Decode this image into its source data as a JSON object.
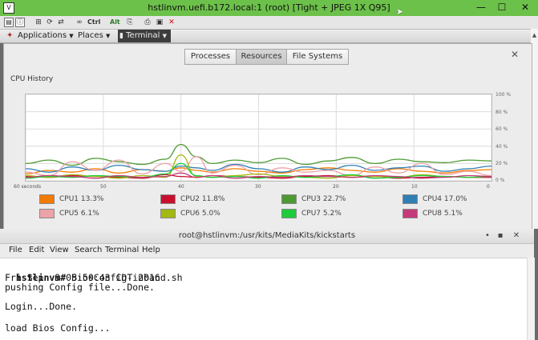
{
  "vnc": {
    "title": "hstlinvm.uefi.b172.local:1 (root) [Tight + JPEG 1X Q95]",
    "controls": {
      "minimize": "—",
      "maximize": "☐",
      "close": "✕"
    },
    "toolbar_texts": {
      "ctrl": "Ctrl",
      "alt": "Alt"
    }
  },
  "panel": {
    "applications": "Applications",
    "places": "Places",
    "terminal_task": "Terminal"
  },
  "sysmon": {
    "tabs": [
      "Processes",
      "Resources",
      "File Systems"
    ],
    "active_tab": "Resources",
    "close_label": "✕",
    "section_title": "CPU History",
    "y_ticks": [
      "100 %",
      "80 %",
      "60 %",
      "40 %",
      "20 %",
      "0 %"
    ],
    "x_ticks": [
      "60 seconds",
      "50",
      "40",
      "30",
      "20",
      "10",
      "0"
    ],
    "legend": [
      {
        "label": "CPU1 13.3%",
        "color": "#f57a00"
      },
      {
        "label": "CPU2 11.8%",
        "color": "#c8102e"
      },
      {
        "label": "CPU3 22.7%",
        "color": "#4e9a32"
      },
      {
        "label": "CPU4 17.0%",
        "color": "#2f7fb5"
      },
      {
        "label": "CPU5 6.1%",
        "color": "#eca2a8"
      },
      {
        "label": "CPU6 5.0%",
        "color": "#a4b812"
      },
      {
        "label": "CPU7 5.2%",
        "color": "#1ccc3a"
      },
      {
        "label": "CPU8 5.1%",
        "color": "#c43b7a"
      }
    ]
  },
  "chart_data": {
    "type": "line",
    "title": "CPU History",
    "x": [
      60,
      57,
      54,
      51,
      48,
      45,
      42,
      40,
      38,
      36,
      33,
      30,
      27,
      24,
      21,
      18,
      15,
      12,
      9,
      6,
      3,
      0
    ],
    "ylim": [
      0,
      100
    ],
    "series": [
      {
        "name": "CPU1",
        "values": [
          8,
          12,
          10,
          14,
          9,
          13,
          11,
          15,
          12,
          10,
          14,
          11,
          9,
          13,
          15,
          12,
          10,
          14,
          11,
          9,
          12,
          13
        ]
      },
      {
        "name": "CPU2",
        "values": [
          5,
          4,
          6,
          5,
          4,
          3,
          7,
          5,
          4,
          6,
          5,
          4,
          3,
          5,
          6,
          4,
          5,
          3,
          4,
          5,
          4,
          4
        ]
      },
      {
        "name": "CPU3",
        "values": [
          20,
          24,
          18,
          26,
          22,
          19,
          25,
          42,
          28,
          20,
          24,
          21,
          26,
          19,
          23,
          27,
          20,
          25,
          22,
          21,
          24,
          23
        ]
      },
      {
        "name": "CPU4",
        "values": [
          14,
          10,
          16,
          12,
          18,
          13,
          11,
          17,
          15,
          12,
          19,
          14,
          10,
          16,
          13,
          18,
          12,
          15,
          17,
          11,
          14,
          17
        ]
      },
      {
        "name": "CPU5",
        "values": [
          10,
          6,
          22,
          12,
          24,
          8,
          20,
          11,
          28,
          9,
          18,
          7,
          15,
          10,
          12,
          6,
          16,
          9,
          20,
          7,
          11,
          6
        ]
      },
      {
        "name": "CPU6",
        "values": [
          6,
          4,
          7,
          5,
          3,
          6,
          4,
          30,
          5,
          4,
          6,
          8,
          5,
          4,
          3,
          6,
          5,
          4,
          7,
          5,
          4,
          5
        ]
      },
      {
        "name": "CPU7",
        "values": [
          3,
          5,
          4,
          6,
          5,
          4,
          8,
          20,
          6,
          4,
          5,
          3,
          6,
          4,
          5,
          7,
          3,
          4,
          6,
          5,
          4,
          5
        ]
      },
      {
        "name": "CPU8",
        "values": [
          4,
          6,
          5,
          3,
          6,
          4,
          5,
          9,
          4,
          6,
          3,
          5,
          4,
          6,
          5,
          4,
          6,
          5,
          3,
          4,
          6,
          5
        ]
      }
    ]
  },
  "terminal": {
    "title": "root@hstlinvm:/usr/kits/MediaKits/kickstarts",
    "controls": {
      "minimize": "•",
      "maximize": "▪",
      "close": "✕"
    },
    "menus": [
      "File",
      "Edit",
      "View",
      "Search",
      "Terminal",
      "Help"
    ],
    "prompt": "hstlinvm#",
    "command": " BiosConfig-inband.sh",
    "lines": [
      "Fri Sep  9 05:50:43 CDT 2016",
      "pushing Config file...Done.",
      "",
      "Login...Done.",
      "",
      "load Bios Config..."
    ]
  }
}
